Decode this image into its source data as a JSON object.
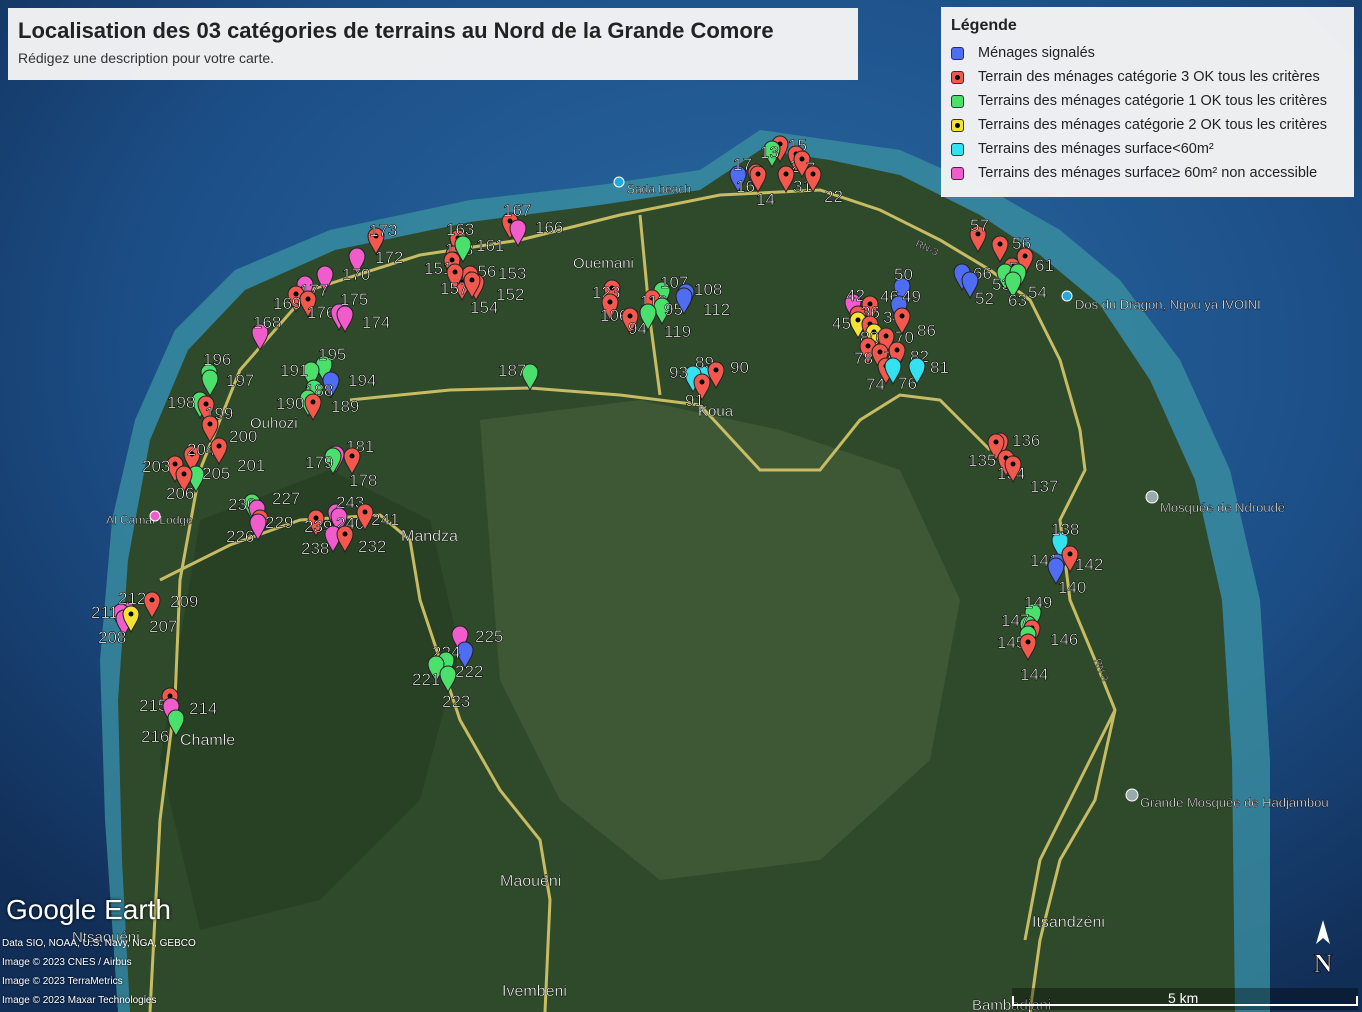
{
  "title": "Localisation des 03 catégories de terrains au Nord de la Grande Comore",
  "subtitle": "Rédigez une description pour votre carte.",
  "legend": {
    "heading": "Légende",
    "items": [
      {
        "label": "Ménages signalés",
        "color": "#4f6df2",
        "dot": false
      },
      {
        "label": "Terrain des ménages catégorie 3 OK tous les critères",
        "color": "#f2584e",
        "dot": true
      },
      {
        "label": "Terrains des ménages catégorie 1 OK tous les critères",
        "color": "#4be06b",
        "dot": false
      },
      {
        "label": "Terrains des ménages catégorie 2 OK tous les critères",
        "color": "#f4e235",
        "dot": true
      },
      {
        "label": "Terrains des ménages surface<60m²",
        "color": "#33e2ee",
        "dot": false
      },
      {
        "label": "Terrains des ménages surface≥ 60m² non accessible",
        "color": "#f05ccc",
        "dot": false
      }
    ]
  },
  "places": [
    "Sada beach",
    "Ouemani",
    "Koua",
    "Ouhozi",
    "Mandza",
    "Al Camar Lodge",
    "Chamle",
    "Maouéni",
    "Ivembeni",
    "Ntsaouéni",
    "Itsandzéni",
    "Bambadjani",
    "Dos du Dragon, Ngou ya IVOINI",
    "Mosquée de Ndroudé",
    "Grande Mosquée de Hadjambou"
  ],
  "road_labels": [
    "RN-3",
    "RN-3"
  ],
  "markers": [
    {
      "id": "15",
      "cat": 1
    },
    {
      "id": "13",
      "cat": 2
    },
    {
      "id": "28",
      "cat": 1
    },
    {
      "id": "7",
      "cat": 1
    },
    {
      "id": "17",
      "cat": 0
    },
    {
      "id": "16",
      "cat": 1
    },
    {
      "id": "14",
      "cat": 1
    },
    {
      "id": "31",
      "cat": 1
    },
    {
      "id": "22",
      "cat": 1
    },
    {
      "id": "167",
      "cat": 1
    },
    {
      "id": "166",
      "cat": 5
    },
    {
      "id": "163",
      "cat": 1
    },
    {
      "id": "158",
      "cat": 1
    },
    {
      "id": "161",
      "cat": 2
    },
    {
      "id": "151",
      "cat": 1
    },
    {
      "id": "156",
      "cat": 1
    },
    {
      "id": "153",
      "cat": 1
    },
    {
      "id": "157",
      "cat": 1
    },
    {
      "id": "152",
      "cat": 1
    },
    {
      "id": "154",
      "cat": 1
    },
    {
      "id": "173",
      "cat": 1
    },
    {
      "id": "172",
      "cat": 5
    },
    {
      "id": "170",
      "cat": 5
    },
    {
      "id": "177",
      "cat": 5
    },
    {
      "id": "169",
      "cat": 1
    },
    {
      "id": "176",
      "cat": 1
    },
    {
      "id": "175",
      "cat": 5
    },
    {
      "id": "174",
      "cat": 5
    },
    {
      "id": "168",
      "cat": 5
    },
    {
      "id": "107",
      "cat": 2
    },
    {
      "id": "108",
      "cat": 0
    },
    {
      "id": "123",
      "cat": 1
    },
    {
      "id": "118",
      "cat": 1
    },
    {
      "id": "95",
      "cat": 2
    },
    {
      "id": "112",
      "cat": 0
    },
    {
      "id": "106",
      "cat": 1
    },
    {
      "id": "94",
      "cat": 1
    },
    {
      "id": "119",
      "cat": 2
    },
    {
      "id": "187",
      "cat": 2
    },
    {
      "id": "89",
      "cat": 4
    },
    {
      "id": "90",
      "cat": 1
    },
    {
      "id": "93",
      "cat": 4
    },
    {
      "id": "91",
      "cat": 1
    },
    {
      "id": "195",
      "cat": 2
    },
    {
      "id": "191",
      "cat": 2
    },
    {
      "id": "194",
      "cat": 0
    },
    {
      "id": "188",
      "cat": 2
    },
    {
      "id": "190",
      "cat": 2
    },
    {
      "id": "189",
      "cat": 1
    },
    {
      "id": "196",
      "cat": 2
    },
    {
      "id": "197",
      "cat": 2
    },
    {
      "id": "198",
      "cat": 2
    },
    {
      "id": "199",
      "cat": 1
    },
    {
      "id": "200",
      "cat": 1
    },
    {
      "id": "204",
      "cat": 1
    },
    {
      "id": "201",
      "cat": 1
    },
    {
      "id": "203",
      "cat": 1
    },
    {
      "id": "205",
      "cat": 2
    },
    {
      "id": "206",
      "cat": 1
    },
    {
      "id": "181",
      "cat": 5
    },
    {
      "id": "179",
      "cat": 2
    },
    {
      "id": "178",
      "cat": 1
    },
    {
      "id": "230",
      "cat": 2
    },
    {
      "id": "227",
      "cat": 5
    },
    {
      "id": "229",
      "cat": 1
    },
    {
      "id": "226",
      "cat": 5
    },
    {
      "id": "243",
      "cat": 5
    },
    {
      "id": "239",
      "cat": 1
    },
    {
      "id": "240",
      "cat": 5
    },
    {
      "id": "241",
      "cat": 1
    },
    {
      "id": "238",
      "cat": 5
    },
    {
      "id": "232",
      "cat": 1
    },
    {
      "id": "212",
      "cat": 5
    },
    {
      "id": "209",
      "cat": 1
    },
    {
      "id": "211",
      "cat": 5
    },
    {
      "id": "208",
      "cat": 5
    },
    {
      "id": "207",
      "cat": 3
    },
    {
      "id": "225",
      "cat": 5
    },
    {
      "id": "224",
      "cat": 0
    },
    {
      "id": "222",
      "cat": 2
    },
    {
      "id": "221",
      "cat": 2
    },
    {
      "id": "223",
      "cat": 2
    },
    {
      "id": "215",
      "cat": 1
    },
    {
      "id": "214",
      "cat": 5
    },
    {
      "id": "216",
      "cat": 2
    },
    {
      "id": "57",
      "cat": 1
    },
    {
      "id": "56",
      "cat": 1
    },
    {
      "id": "66",
      "cat": 0
    },
    {
      "id": "58",
      "cat": 1
    },
    {
      "id": "61",
      "cat": 1
    },
    {
      "id": "53",
      "cat": 2
    },
    {
      "id": "54",
      "cat": 2
    },
    {
      "id": "52",
      "cat": 0
    },
    {
      "id": "63",
      "cat": 2
    },
    {
      "id": "50",
      "cat": 0
    },
    {
      "id": "42",
      "cat": 5
    },
    {
      "id": "46",
      "cat": 1
    },
    {
      "id": "49",
      "cat": 0
    },
    {
      "id": "36",
      "cat": 1
    },
    {
      "id": "45",
      "cat": 3
    },
    {
      "id": "34",
      "cat": 1
    },
    {
      "id": "80",
      "cat": 3
    },
    {
      "id": "70",
      "cat": 1
    },
    {
      "id": "86",
      "cat": 1
    },
    {
      "id": "78",
      "cat": 1
    },
    {
      "id": "75",
      "cat": 1
    },
    {
      "id": "82",
      "cat": 1
    },
    {
      "id": "74",
      "cat": 1
    },
    {
      "id": "76",
      "cat": 4
    },
    {
      "id": "81",
      "cat": 4
    },
    {
      "id": "136",
      "cat": 1
    },
    {
      "id": "135",
      "cat": 1
    },
    {
      "id": "134",
      "cat": 1
    },
    {
      "id": "137",
      "cat": 1
    },
    {
      "id": "138",
      "cat": 4
    },
    {
      "id": "141",
      "cat": 0
    },
    {
      "id": "142",
      "cat": 1
    },
    {
      "id": "140",
      "cat": 0
    },
    {
      "id": "149",
      "cat": 2
    },
    {
      "id": "147",
      "cat": 2
    },
    {
      "id": "146",
      "cat": 1
    },
    {
      "id": "145",
      "cat": 2
    },
    {
      "id": "144",
      "cat": 1
    }
  ],
  "attribution": [
    "Data SIO, NOAA, U.S. Navy, NGA, GEBCO",
    "Image © 2023 CNES / Airbus",
    "Image © 2023 TerraMetrics",
    "Image © 2023 Maxar Technologies"
  ],
  "logo": "Google Earth",
  "scale_label": "5 km",
  "north_label": "N"
}
